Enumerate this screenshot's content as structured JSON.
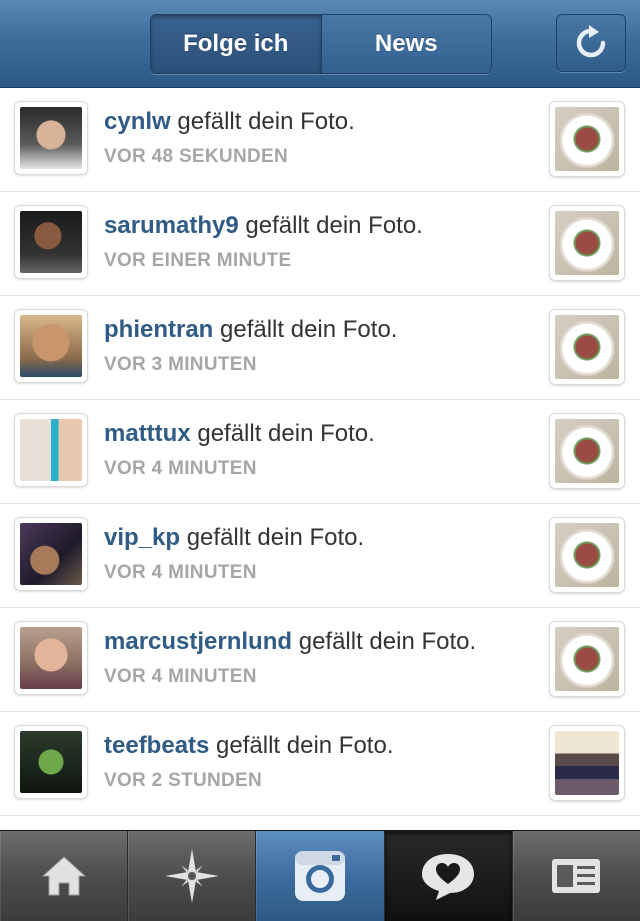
{
  "header": {
    "tabs": [
      {
        "label": "Folge ich",
        "active": true
      },
      {
        "label": "News",
        "active": false
      }
    ],
    "refresh_icon": "refresh-icon"
  },
  "feed": [
    {
      "user": "cynlw",
      "action": "gefällt dein Foto.",
      "time": "VOR 48 SEKUNDEN",
      "thumb": "food-plate"
    },
    {
      "user": "sarumathy9",
      "action": "gefällt dein Foto.",
      "time": "VOR EINER MINUTE",
      "thumb": "food-plate"
    },
    {
      "user": "phientran",
      "action": "gefällt dein Foto.",
      "time": "VOR 3 MINUTEN",
      "thumb": "food-plate"
    },
    {
      "user": "matttux",
      "action": "gefällt dein Foto.",
      "time": "VOR 4 MINUTEN",
      "thumb": "food-plate"
    },
    {
      "user": "vip_kp",
      "action": "gefällt dein Foto.",
      "time": "VOR 4 MINUTEN",
      "thumb": "food-plate"
    },
    {
      "user": "marcustjernlund",
      "action": "gefällt dein Foto.",
      "time": "VOR 4 MINUTEN",
      "thumb": "food-plate"
    },
    {
      "user": "teefbeats",
      "action": "gefällt dein Foto.",
      "time": "VOR 2 STUNDEN",
      "thumb": "crowd-photo"
    }
  ],
  "tabbar": {
    "items": [
      {
        "icon": "home-icon"
      },
      {
        "icon": "explore-star-icon"
      },
      {
        "icon": "camera-icon"
      },
      {
        "icon": "news-heart-bubble-icon",
        "selected": true
      },
      {
        "icon": "profile-card-icon"
      }
    ]
  },
  "colors": {
    "header_blue": "#3e6d9b",
    "username_blue": "#2f5b85",
    "time_gray": "#a6a6a6"
  }
}
